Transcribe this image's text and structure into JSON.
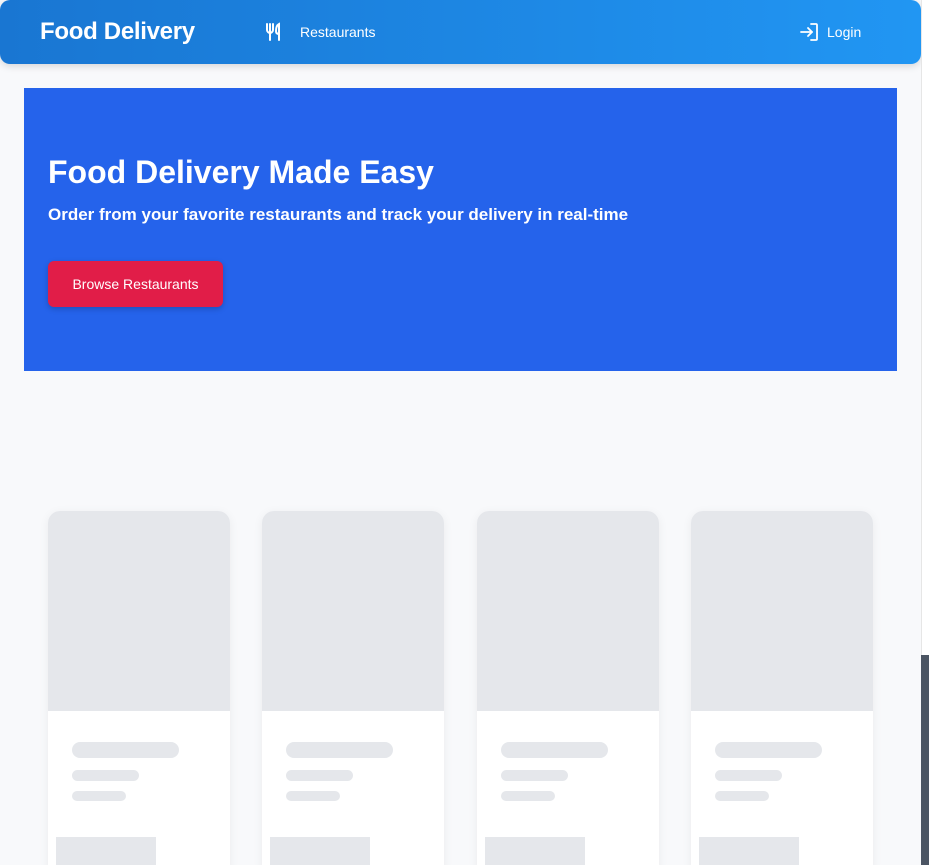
{
  "navbar": {
    "brand": "Food Delivery",
    "restaurants_label": "Restaurants",
    "restaurants_icon": "utensils-icon",
    "login_label": "Login",
    "login_icon": "login-icon",
    "gradient_start": "#1976d2",
    "gradient_end": "#2196f3"
  },
  "hero": {
    "title": "Food Delivery Made Easy",
    "subtitle": "Order from your favorite restaurants and track your delivery in real-time",
    "button_label": "Browse Restaurants",
    "background": "#2563eb",
    "button_color": "#e11d48"
  },
  "restaurant_cards": {
    "state": "loading",
    "count": 4,
    "skeleton_color": "#e5e7eb"
  }
}
